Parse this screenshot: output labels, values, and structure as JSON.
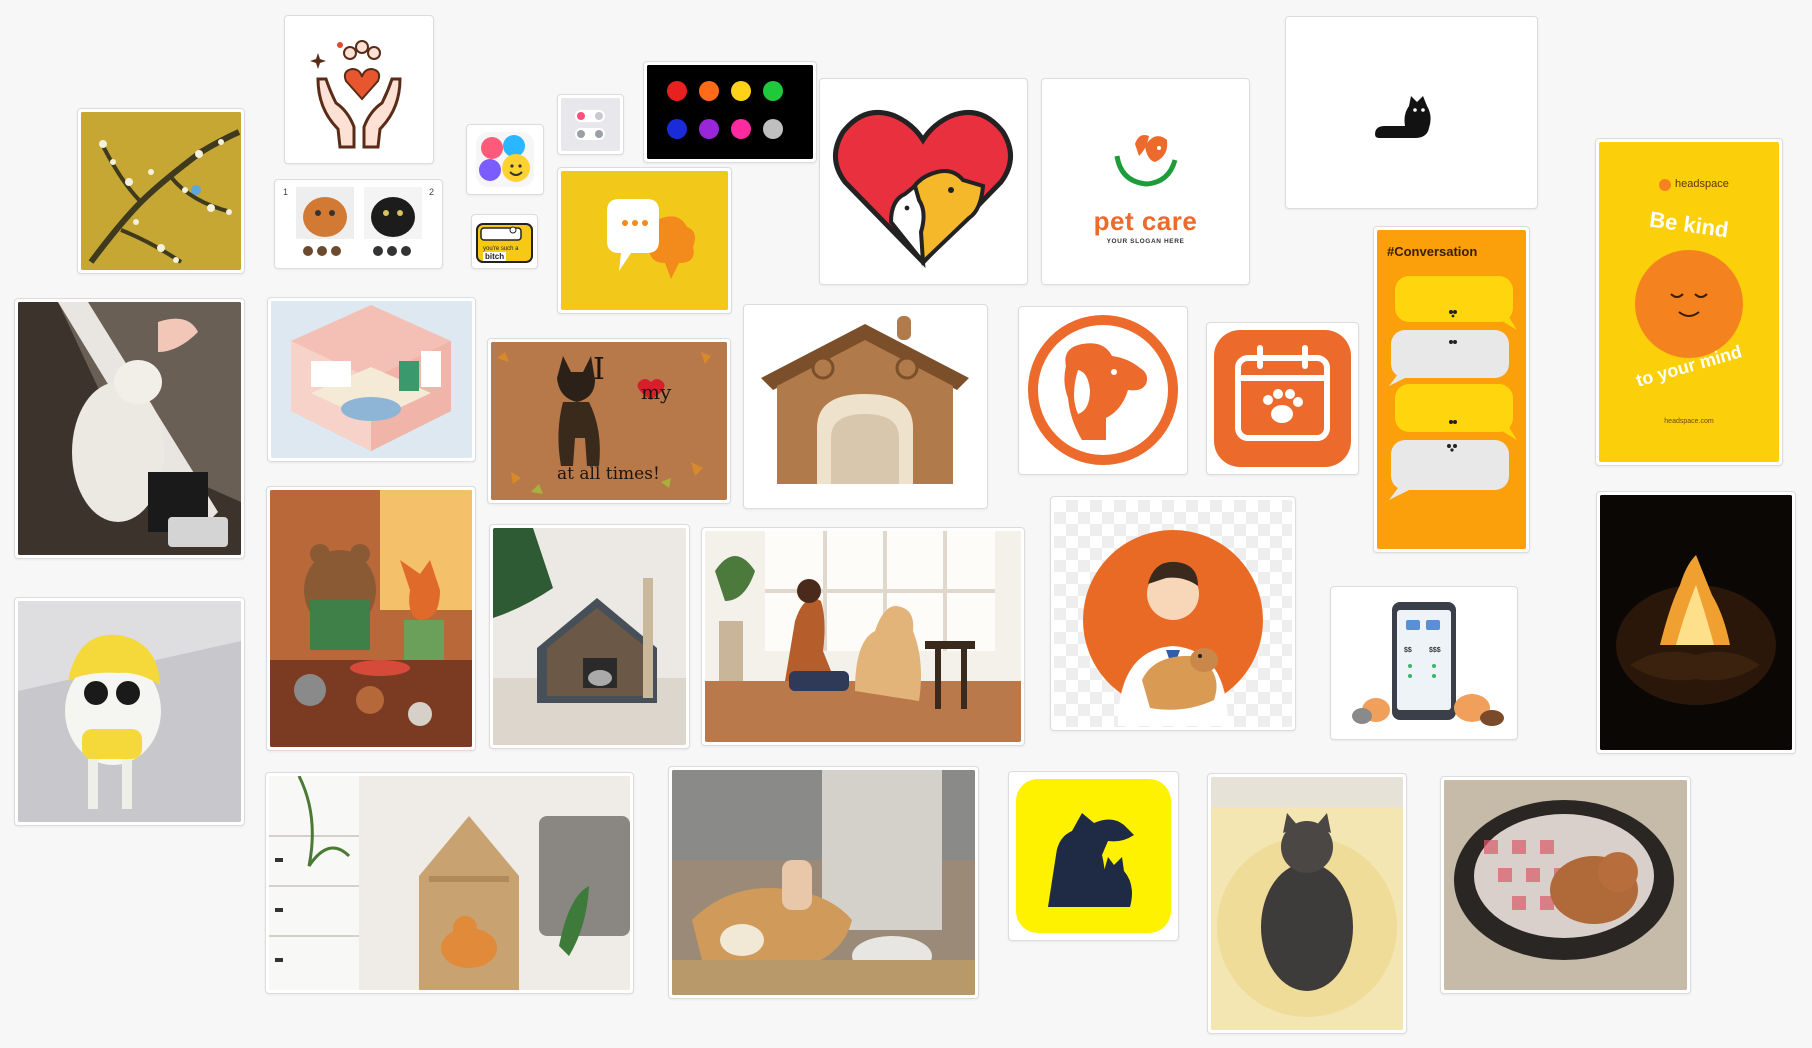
{
  "board": {
    "kind": "moodboard",
    "item_count": 30
  },
  "cards": {
    "van_gogh": {
      "alt": "almond blossom painting"
    },
    "paw_hands": {
      "icon": "paw-heart-hands-icon"
    },
    "cat_sheet": {
      "left_number": "1",
      "right_number": "2"
    },
    "face_app": {
      "icon": "color-faces-app-icon"
    },
    "toggle_ui": {
      "icon": "toggle-switches-icon"
    },
    "blob_grid": {
      "icon": "colored-blob-characters"
    },
    "croc_sticker": {
      "text1": "you're such a",
      "text2": "bitch"
    },
    "chat_logo": {
      "icon": "chat-bubble-logo"
    },
    "dogcat_heart": {
      "icon": "dog-cat-heart-logo"
    },
    "pet_care": {
      "title": "pet care",
      "slogan": "YOUR SLOGAN HERE"
    },
    "black_cat": {
      "icon": "black-cat-icon"
    },
    "conversation": {
      "heading": "#Conversation"
    },
    "headspace": {
      "brand": "headspace",
      "line1": "Be kind",
      "line2": "to your mind",
      "url": "headspace.com"
    },
    "doormat": {
      "line1": "I",
      "line2": "my",
      "line3": "at all times!"
    },
    "dog_logo": {
      "icon": "orange-dog-circle-logo"
    },
    "calendar_app": {
      "icon": "paw-calendar-app-icon"
    },
    "vet_doctor": {
      "icon": "vet-holding-dog-illustration"
    },
    "pet_app": {
      "price1": "$$",
      "price2": "$$$"
    },
    "dogcat_yellow": {
      "icon": "dog-cat-silhouette-app-icon"
    }
  },
  "colors": {
    "orange": "#ec6a2c",
    "yellow": "#f6c915",
    "headspace_yellow": "#fbcf0a",
    "headspace_orange": "#f4831f",
    "red": "#e03340",
    "green": "#1d9d3a",
    "navy": "#1f2a44"
  }
}
